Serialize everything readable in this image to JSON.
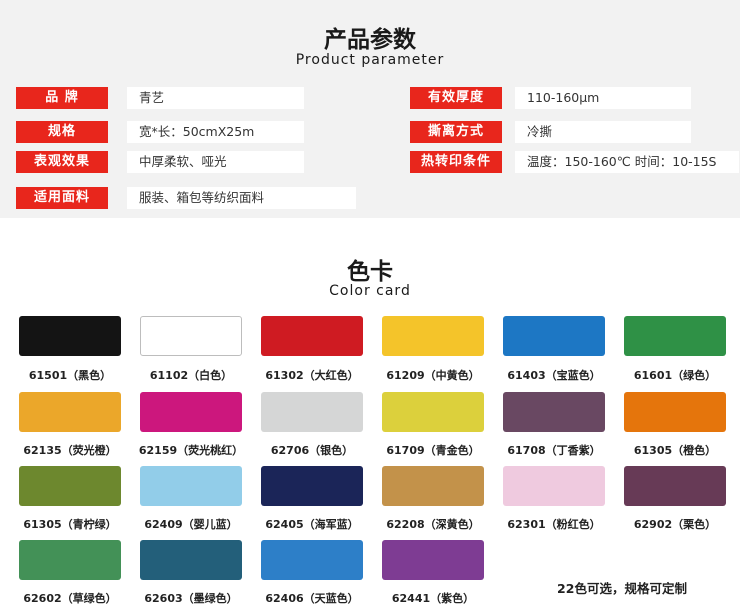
{
  "params": {
    "title_zh": "产品参数",
    "title_en": "Product parameter",
    "rows": [
      {
        "label": "品 牌",
        "value": "青艺"
      },
      {
        "label": "有效厚度",
        "value": "110-160μm"
      },
      {
        "label": "规格",
        "value": "宽*长：50cmX25m"
      },
      {
        "label": "撕离方式",
        "value": "冷撕"
      },
      {
        "label": "表观效果",
        "value": "中厚柔软、哑光"
      },
      {
        "label": "热转印条件",
        "value": "温度：150-160℃ 时间：10-15S"
      },
      {
        "label": "适用面料",
        "value": "服装、箱包等纺织面料"
      }
    ]
  },
  "colorcard": {
    "title_zh": "色卡",
    "title_en": "Color card",
    "note": "22色可选，规格可定制",
    "swatches": [
      {
        "code": "61501（黑色）",
        "color": "#141414"
      },
      {
        "code": "61102（白色）",
        "color": "#ffffff"
      },
      {
        "code": "61302（大红色）",
        "color": "#cf1b22"
      },
      {
        "code": "61209（中黄色）",
        "color": "#f4c42a"
      },
      {
        "code": "61403（宝蓝色）",
        "color": "#1d77c4"
      },
      {
        "code": "61601（绿色）",
        "color": "#2f9146"
      },
      {
        "code": "62135（荧光橙）",
        "color": "#eba72a"
      },
      {
        "code": "62159（荧光桃红）",
        "color": "#cc177d"
      },
      {
        "code": "62706（银色）",
        "color": "#d5d6d6"
      },
      {
        "code": "61709（青金色）",
        "color": "#dcd03c"
      },
      {
        "code": "61708（丁香紫）",
        "color": "#694862"
      },
      {
        "code": "61305（橙色）",
        "color": "#e5750c"
      },
      {
        "code": "61305（青柠绿）",
        "color": "#6d882e"
      },
      {
        "code": "62409（婴儿蓝）",
        "color": "#92cde9"
      },
      {
        "code": "62405（海军蓝）",
        "color": "#1b2558"
      },
      {
        "code": "62208（深黄色）",
        "color": "#c3924a"
      },
      {
        "code": "62301（粉红色）",
        "color": "#efcadf"
      },
      {
        "code": "62902（栗色）",
        "color": "#673a56"
      },
      {
        "code": "62602（草绿色）",
        "color": "#439157"
      },
      {
        "code": "62603（墨绿色）",
        "color": "#235f7a"
      },
      {
        "code": "62406（天蓝色）",
        "color": "#2d7fc8"
      },
      {
        "code": "62441（紫色）",
        "color": "#7e3c93"
      }
    ]
  }
}
